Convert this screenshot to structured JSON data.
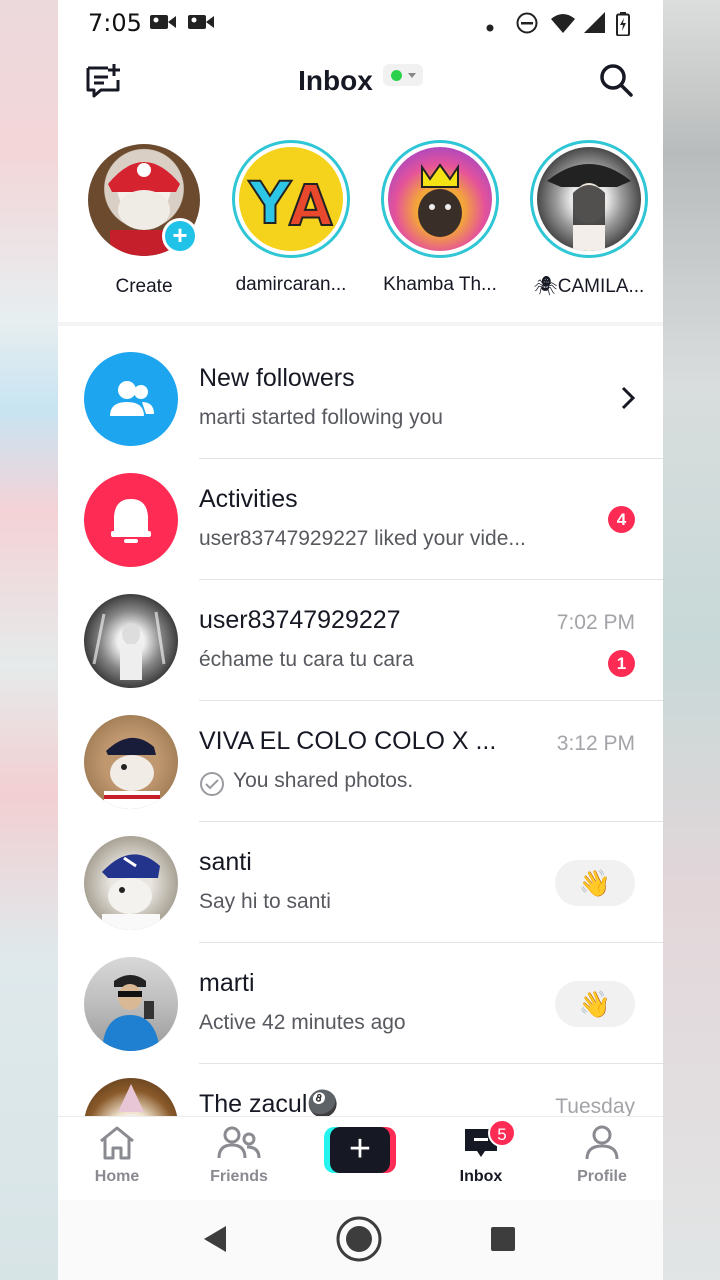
{
  "status_bar": {
    "time": "7:05",
    "icons": [
      "video-icon",
      "video-icon",
      "dot-icon",
      "dnd-icon",
      "wifi-icon",
      "signal-icon",
      "battery-icon"
    ]
  },
  "header": {
    "title": "Inbox",
    "online_status_color": "#2bd14a",
    "left_icon": "new-message-icon",
    "right_icon": "search-icon"
  },
  "stories": [
    {
      "label": "Create",
      "ring": false,
      "badge": "+"
    },
    {
      "label": "damircaran...",
      "ring": true
    },
    {
      "label": "Khamba Th...",
      "ring": true
    },
    {
      "label": "🕷CAMILA...",
      "ring": true
    }
  ],
  "rows": [
    {
      "name": "New followers",
      "sub": "marti started following you",
      "icon": "followers-icon",
      "trailing": "chevron-right-icon"
    },
    {
      "name": "Activities",
      "sub": "user83747929227 liked your vide...",
      "icon": "bell-icon",
      "badge": "4"
    },
    {
      "name": "user83747929227",
      "sub": "échame tu cara tu cara",
      "time": "7:02 PM",
      "badge": "1"
    },
    {
      "name": "VIVA EL COLO COLO X ...",
      "sub": "You shared photos.",
      "time": "3:12 PM",
      "sub_icon": "check-circle-icon"
    },
    {
      "name": "santi",
      "sub": "Say hi to santi",
      "action": "👋"
    },
    {
      "name": "marti",
      "sub": "Active 42 minutes ago",
      "action": "👋"
    },
    {
      "name": "The zacul🎱",
      "time": "Tuesday"
    }
  ],
  "bottom_nav": [
    {
      "label": "Home",
      "icon": "home-icon"
    },
    {
      "label": "Friends",
      "icon": "friends-icon"
    },
    {
      "label": "",
      "icon": "create-plus-icon"
    },
    {
      "label": "Inbox",
      "icon": "inbox-icon",
      "badge": "5",
      "active": true
    },
    {
      "label": "Profile",
      "icon": "profile-icon"
    }
  ],
  "colors": {
    "accent_red": "#fe2c55",
    "accent_cyan": "#25f4ee",
    "followers_blue": "#1ea5f0",
    "activities_pink": "#fe2c55",
    "story_ring": "#2fc6d6"
  }
}
